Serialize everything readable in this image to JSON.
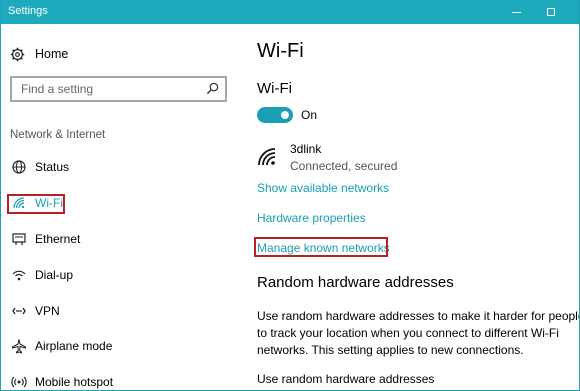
{
  "window": {
    "title": "Settings"
  },
  "sidebar": {
    "home_label": "Home",
    "search_placeholder": "Find a setting",
    "section_label": "Network & Internet",
    "items": [
      {
        "label": "Status",
        "icon": "globe-icon"
      },
      {
        "label": "Wi-Fi",
        "icon": "wifi-icon",
        "active": true
      },
      {
        "label": "Ethernet",
        "icon": "ethernet-icon"
      },
      {
        "label": "Dial-up",
        "icon": "dialup-icon"
      },
      {
        "label": "VPN",
        "icon": "vpn-icon"
      },
      {
        "label": "Airplane mode",
        "icon": "airplane-icon"
      },
      {
        "label": "Mobile hotspot",
        "icon": "hotspot-icon"
      }
    ]
  },
  "main": {
    "page_title": "Wi-Fi",
    "wifi_heading": "Wi-Fi",
    "toggle_state": "On",
    "network": {
      "name": "3dlink",
      "status": "Connected, secured"
    },
    "links": {
      "show_available": "Show available networks",
      "hardware_properties": "Hardware properties",
      "manage_known": "Manage known networks"
    },
    "random_heading": "Random hardware addresses",
    "random_description": "Use random hardware addresses to make it harder for people to track your location when you connect to different Wi-Fi networks. This setting applies to new connections.",
    "random_sublabel": "Use random hardware addresses"
  },
  "colors": {
    "accent": "#1a9fb4",
    "titlebar": "#1fa9bc",
    "highlight_box": "#b42222"
  }
}
